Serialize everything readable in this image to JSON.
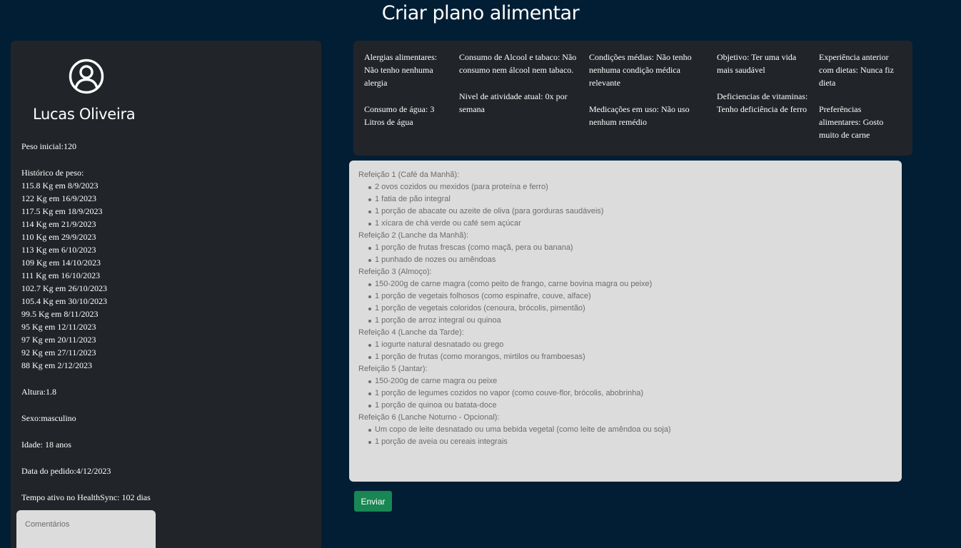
{
  "page": {
    "title": "Criar plano alimentar"
  },
  "user": {
    "name": "Lucas Oliveira",
    "avatar_icon": "user-circle-icon",
    "initial_weight": "Peso inicial:120",
    "weight_history_title": "Histórico de peso:",
    "weight_history": [
      "115.8 Kg em 8/9/2023",
      "122 Kg em 16/9/2023",
      "117.5 Kg em 18/9/2023",
      "114 Kg em 21/9/2023",
      "110 Kg em 29/9/2023",
      "113 Kg em 6/10/2023",
      "109 Kg em 14/10/2023",
      "111 Kg em 16/10/2023",
      "102.7 Kg em 26/10/2023",
      "105.4 Kg em 30/10/2023",
      "99.5 Kg em 8/11/2023",
      "95 Kg em 12/11/2023",
      "97 Kg em 20/11/2023",
      "92 Kg em 27/11/2023",
      "88 Kg em 2/12/2023"
    ],
    "height": "Altura:1.8",
    "sex": "Sexo:masculino",
    "age": "Idade: 18 anos",
    "request_date": "Data do pedido:4/12/2023",
    "active_time": "Tempo ativo no HealthSync: 102 dias"
  },
  "comments": {
    "placeholder": "Comentários"
  },
  "patient_info": {
    "allergies": "Alergias alimentares: Não tenho nenhuma alergia",
    "water": "Consumo de água: 3 Litros de água",
    "alcohol_tobacco": "Consumo de Alcool e tabaco: Não consumo nem álcool nem tabaco.",
    "activity_level": "Nivel de atividade atual: 0x por semana",
    "medical_conditions": "Condições médias: Não tenho nenhuma condição médica relevante",
    "medications": "Medicações em uso: Não uso nenhum remédio",
    "goal": "Objetivo: Ter uma vida mais saudável",
    "vitamin_deficiencies": "Deficiencias de vitaminas: Tenho deficiência de ferro",
    "diet_experience": "Experiência anterior com dietas: Nunca fiz dieta",
    "food_preferences": "Preferências alimentares: Gosto muito de carne"
  },
  "meal_plan": [
    {
      "title": "Refeição 1 (Café da Manhã):",
      "items": [
        "2 ovos cozidos ou mexidos (para proteína e ferro)",
        "1 fatia de pão integral",
        "1 porção de abacate ou azeite de oliva (para gorduras saudáveis)",
        "1 xícara de chá verde ou café sem açúcar"
      ]
    },
    {
      "title": "Refeição 2 (Lanche da Manhã):",
      "items": [
        "1 porção de frutas frescas (como maçã, pera ou banana)",
        "1 punhado de nozes ou amêndoas"
      ]
    },
    {
      "title": "Refeição 3 (Almoço):",
      "items": [
        "150-200g de carne magra (como peito de frango, carne bovina magra ou peixe)",
        "1 porção de vegetais folhosos (como espinafre, couve, alface)",
        "1 porção de vegetais coloridos (cenoura, brócolis, pimentão)",
        "1 porção de arroz integral ou quinoa"
      ]
    },
    {
      "title": "Refeição 4 (Lanche da Tarde):",
      "items": [
        "1 iogurte natural desnatado ou grego",
        "1 porção de frutas (como morangos, mirtilos ou framboesas)"
      ]
    },
    {
      "title": "Refeição 5 (Jantar):",
      "items": [
        "150-200g de carne magra ou peixe",
        "1 porção de legumes cozidos no vapor (como couve-flor, brócolis, abobrinha)",
        "1 porção de quinoa ou batata-doce"
      ]
    },
    {
      "title": "Refeição 6 (Lanche Noturno - Opcional):",
      "items": [
        "Um copo de leite desnatado ou uma bebida vegetal (como leite de amêndoa ou soja)",
        "1 porção de aveia ou cereais integrais"
      ]
    }
  ],
  "actions": {
    "send_label": "Enviar"
  },
  "colors": {
    "page_background": "#011e34",
    "card_background": "#212529",
    "textarea_background": "#dcdcdc",
    "send_button": "#198754"
  }
}
